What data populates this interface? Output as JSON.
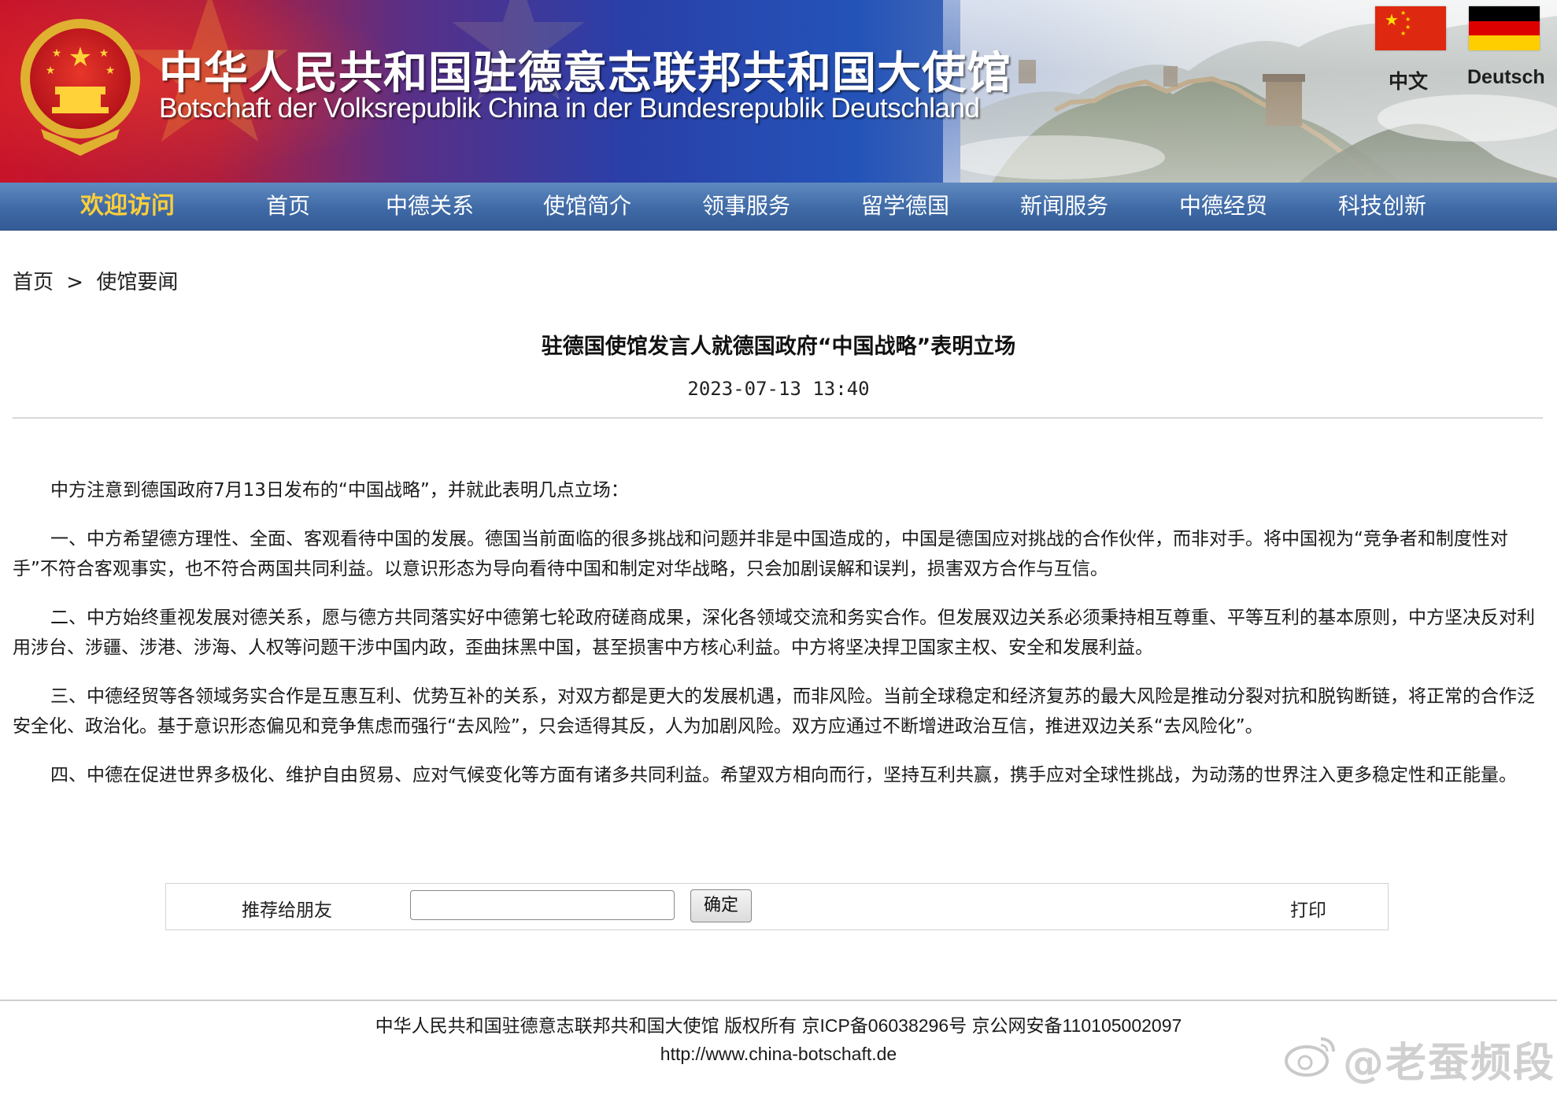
{
  "header": {
    "title_cn": "中华人民共和国驻德意志联邦共和国大使馆",
    "title_de": "Botschaft der Volksrepublik China in der Bundesrepublik Deutschland",
    "lang_cn": "中文",
    "lang_de": "Deutsch"
  },
  "nav": {
    "items": [
      "欢迎访问",
      "首页",
      "中德关系",
      "使馆简介",
      "领事服务",
      "留学德国",
      "新闻服务",
      "中德经贸",
      "科技创新"
    ],
    "active_color": "#ffcf3a"
  },
  "breadcrumb": {
    "home": "首页",
    "separator": ">",
    "current": "使馆要闻"
  },
  "article": {
    "title": "驻德国使馆发言人就德国政府“中国战略”表明立场",
    "date": "2023-07-13 13:40",
    "paragraphs": [
      "中方注意到德国政府7月13日发布的“中国战略”，并就此表明几点立场：",
      "一、中方希望德方理性、全面、客观看待中国的发展。德国当前面临的很多挑战和问题并非是中国造成的，中国是德国应对挑战的合作伙伴，而非对手。将中国视为“竞争者和制度性对手”不符合客观事实，也不符合两国共同利益。以意识形态为导向看待中国和制定对华战略，只会加剧误解和误判，损害双方合作与互信。",
      "二、中方始终重视发展对德关系，愿与德方共同落实好中德第七轮政府磋商成果，深化各领域交流和务实合作。但发展双边关系必须秉持相互尊重、平等互利的基本原则，中方坚决反对利用涉台、涉疆、涉港、涉海、人权等问题干涉中国内政，歪曲抹黑中国，甚至损害中方核心利益。中方将坚决捍卫国家主权、安全和发展利益。",
      "三、中德经贸等各领域务实合作是互惠互利、优势互补的关系，对双方都是更大的发展机遇，而非风险。当前全球稳定和经济复苏的最大风险是推动分裂对抗和脱钩断链，将正常的合作泛安全化、政治化。基于意识形态偏见和竞争焦虑而强行“去风险”，只会适得其反，人为加剧风险。双方应通过不断增进政治互信，推进双边关系“去风险化”。",
      "四、中德在促进世界多极化、维护自由贸易、应对气候变化等方面有诸多共同利益。希望双方相向而行，坚持互利共赢，携手应对全球性挑战，为动荡的世界注入更多稳定性和正能量。"
    ]
  },
  "recommend": {
    "label": "推荐给朋友",
    "input_value": "",
    "confirm_label": "确定",
    "print_label": "打印"
  },
  "footer": {
    "copyright": "中华人民共和国驻德意志联邦共和国大使馆 版权所有 京ICP备06038296号 京公网安备110105002097",
    "url": "http://www.china-botschaft.de"
  },
  "watermark": {
    "text": "@老蚕频段",
    "icon": "weibo-icon"
  },
  "colors": {
    "nav_bg": "#3f6aa6",
    "banner_red": "#c8142a",
    "banner_blue": "#2453b8"
  }
}
